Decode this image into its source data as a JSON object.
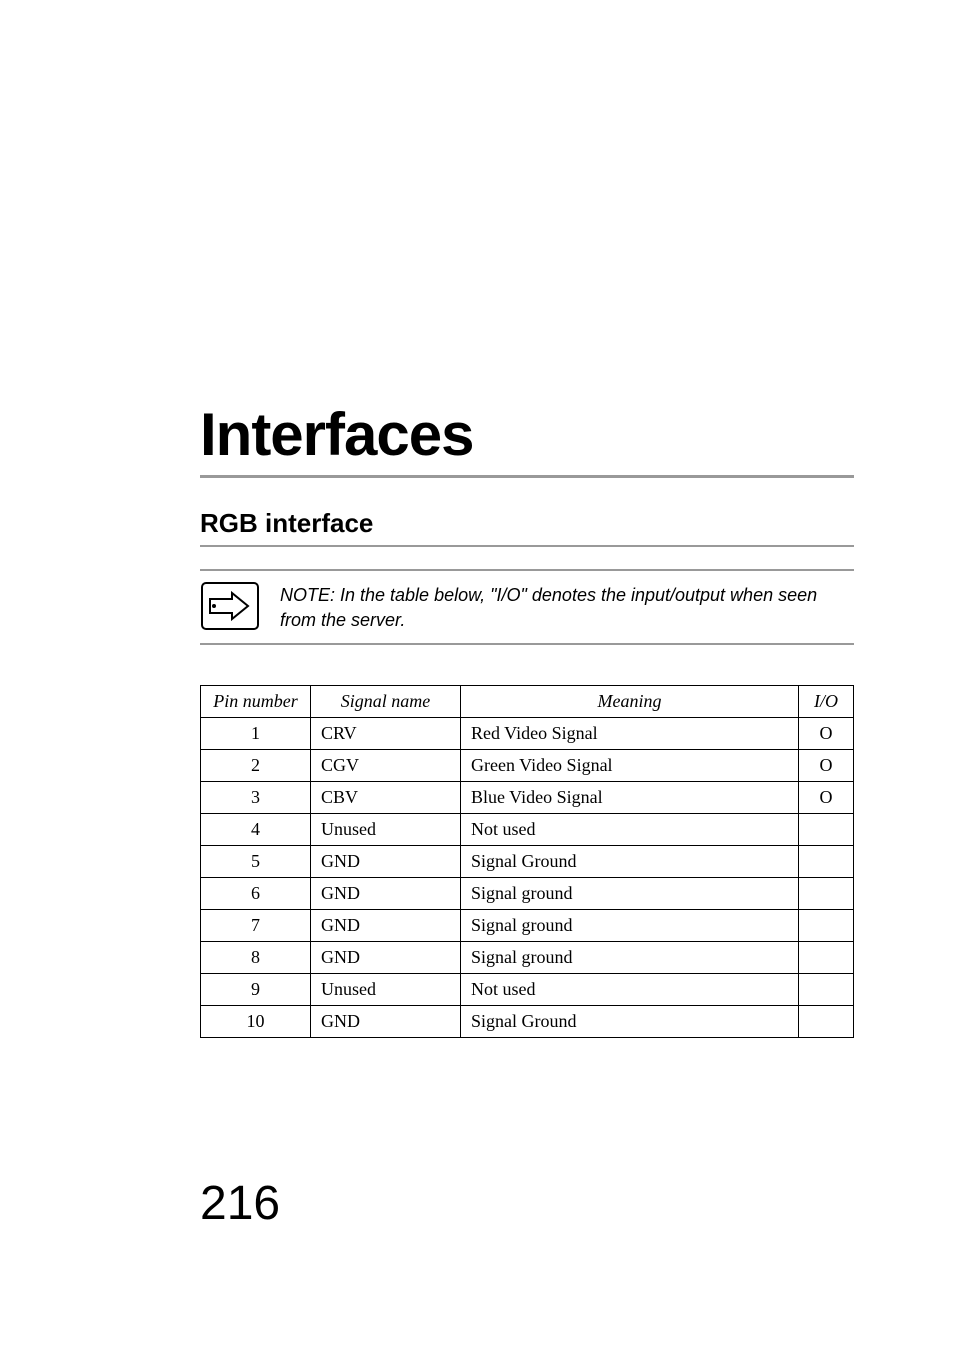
{
  "title": "Interfaces",
  "subtitle": "RGB interface",
  "note": "NOTE: In the table below, \"I/O\" denotes the input/output when seen from the server.",
  "table": {
    "headers": [
      "Pin number",
      "Signal name",
      "Meaning",
      "I/O"
    ],
    "rows": [
      {
        "pin": "1",
        "signal": "CRV",
        "meaning": "Red Video Signal",
        "io": "O"
      },
      {
        "pin": "2",
        "signal": "CGV",
        "meaning": "Green Video Signal",
        "io": "O"
      },
      {
        "pin": "3",
        "signal": "CBV",
        "meaning": "Blue Video Signal",
        "io": "O"
      },
      {
        "pin": "4",
        "signal": "Unused",
        "meaning": "Not used",
        "io": ""
      },
      {
        "pin": "5",
        "signal": "GND",
        "meaning": "Signal Ground",
        "io": ""
      },
      {
        "pin": "6",
        "signal": "GND",
        "meaning": "Signal ground",
        "io": ""
      },
      {
        "pin": "7",
        "signal": "GND",
        "meaning": "Signal ground",
        "io": ""
      },
      {
        "pin": "8",
        "signal": "GND",
        "meaning": "Signal ground",
        "io": ""
      },
      {
        "pin": "9",
        "signal": "Unused",
        "meaning": "Not used",
        "io": ""
      },
      {
        "pin": "10",
        "signal": "GND",
        "meaning": "Signal Ground",
        "io": ""
      }
    ]
  },
  "page_number": "216"
}
